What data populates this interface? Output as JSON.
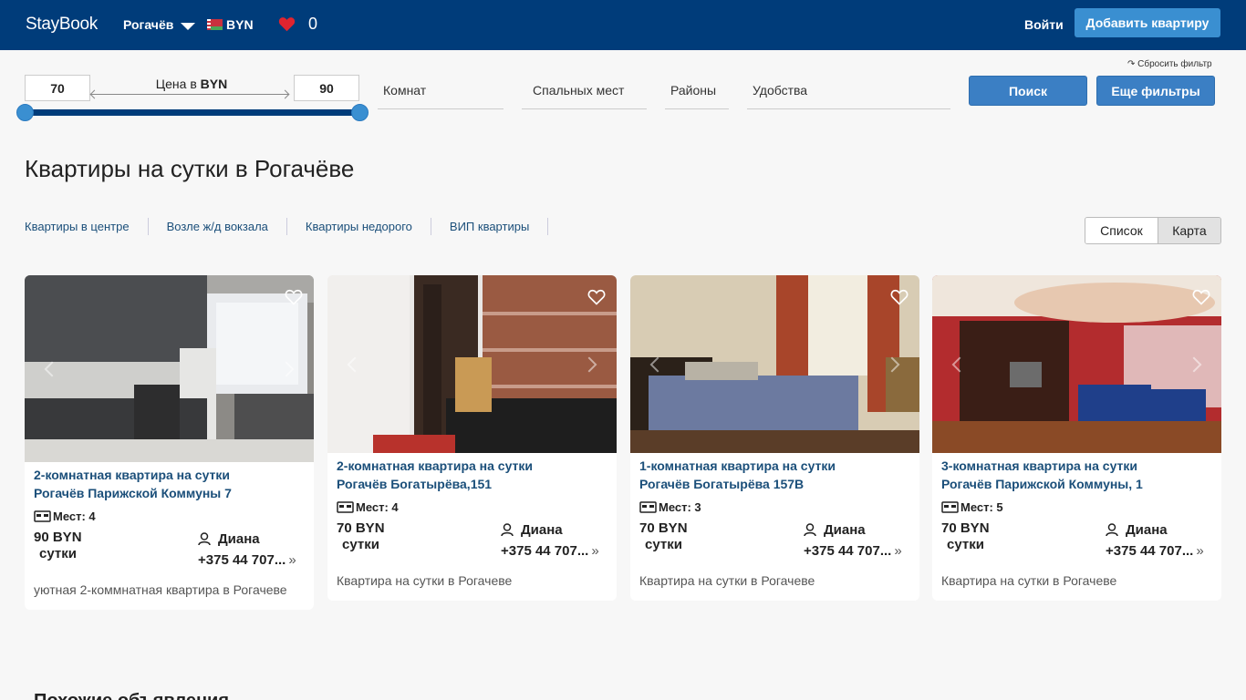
{
  "header": {
    "logo": "StayBook",
    "city": "Рогачёв",
    "currency": "BYN",
    "favorites_count": "0",
    "login": "Войти",
    "add_button": "Добавить квартиру"
  },
  "filters": {
    "reset": "↷ Сбросить фильтр",
    "price_min": "70",
    "price_max": "90",
    "price_label": "Цена в",
    "price_currency": "BYN",
    "rooms": "Комнат",
    "beds": "Спальных мест",
    "districts": "Районы",
    "amenities": "Удобства",
    "search_button": "Поиск",
    "more_filters_button": "Еще фильтры"
  },
  "page_title": "Квартиры на сутки в Рогачёве",
  "quick_links": [
    "Квартиры в центре",
    "Возле ж/д вокзала",
    "Квартиры недорого",
    "ВИП квартиры"
  ],
  "view_toggle": {
    "list": "Список",
    "map": "Карта"
  },
  "listings": [
    {
      "title_line1": "2-комнатная квартира на сутки",
      "title_line2": "Рогачёв Парижской Коммуны 7",
      "places": "Мест: 4",
      "price": "90 BYN",
      "per": "сутки",
      "owner": "Диана",
      "phone": "+375 44 707...",
      "description": "уютная 2-коммнатная квартира в Рогачеве"
    },
    {
      "title_line1": "2-комнатная квартира на сутки",
      "title_line2": "Рогачёв Богатырёва,151",
      "places": "Мест: 4",
      "price": "70 BYN",
      "per": "сутки",
      "owner": "Диана",
      "phone": "+375 44 707...",
      "description": "Квартира на сутки в Рогачеве"
    },
    {
      "title_line1": "1-комнатная квартира на сутки",
      "title_line2": "Рогачёв Богатырёва 157В",
      "places": "Мест: 3",
      "price": "70 BYN",
      "per": "сутки",
      "owner": "Диана",
      "phone": "+375 44 707...",
      "description": "Квартира на сутки в Рогачеве"
    },
    {
      "title_line1": "3-комнатная квартира на сутки",
      "title_line2": "Рогачёв Парижской Коммуны, 1",
      "places": "Мест: 5",
      "price": "70 BYN",
      "per": "сутки",
      "owner": "Диана",
      "phone": "+375 44 707...",
      "description": "Квартира на сутки в Рогачеве"
    }
  ],
  "next_section_heading": "Похожие объявления",
  "colors": {
    "header": "#003c7a",
    "accent": "#3a8fd1",
    "link": "#1b4f7a"
  }
}
